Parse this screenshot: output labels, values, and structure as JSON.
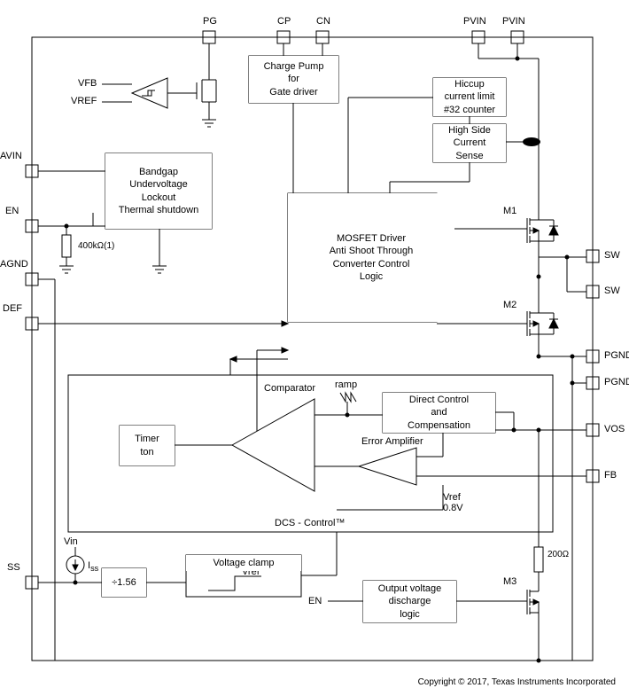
{
  "pins": {
    "PG": "PG",
    "CP": "CP",
    "CN": "CN",
    "PVIN1": "PVIN",
    "PVIN2": "PVIN",
    "AVIN": "AVIN",
    "EN": "EN",
    "AGND": "AGND",
    "DEF": "DEF",
    "SS": "SS",
    "SW1": "SW",
    "SW2": "SW",
    "PGND1": "PGND",
    "PGND2": "PGND",
    "VOS": "VOS",
    "FB": "FB"
  },
  "labels": {
    "VFB": "VFB",
    "VREF": "VREF",
    "resistor_400k": "400kΩ(1)",
    "resistor_200": "200Ω",
    "M1": "M1",
    "M2": "M2",
    "M3": "M3",
    "Vin": "Vin",
    "Iss": "I",
    "Iss_sub": "ss",
    "Vref08": "Vref\n0.8V",
    "ramp": "ramp",
    "Comparator": "Comparator",
    "ErrorAmp": "Error Amplifier",
    "EN_out": "EN",
    "Vref_clamp": "Vref"
  },
  "blocks": {
    "charge_pump": "Charge Pump\nfor\nGate driver",
    "hiccup": "Hiccup\ncurrent limit\n#32 counter",
    "high_side": "High Side\nCurrent\nSense",
    "bandgap": "Bandgap\nUndervoltage\nLockout\nThermal shutdown",
    "mosfet_driver": "MOSFET Driver\nAnti Shoot Through\nConverter Control\nLogic",
    "timer": "Timer\nton",
    "direct_control": "Direct Control\nand\nCompensation",
    "dcs_control": "DCS - Control™",
    "divider": "÷1.56",
    "voltage_clamp": "Voltage clamp",
    "output_discharge": "Output voltage\ndischarge\nlogic"
  },
  "copyright": "Copyright © 2017, Texas Instruments Incorporated"
}
